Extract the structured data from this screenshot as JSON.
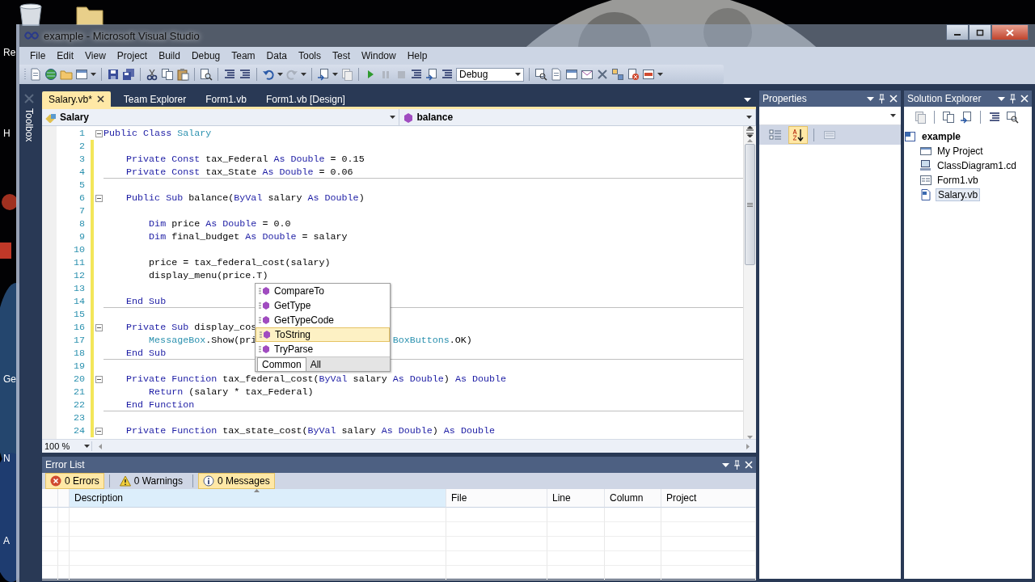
{
  "desktop": {
    "icon_labels": [
      "Re",
      "H",
      "Ge",
      "N",
      "A"
    ]
  },
  "window": {
    "title": "example - Microsoft Visual Studio"
  },
  "menu": [
    "File",
    "Edit",
    "View",
    "Project",
    "Build",
    "Debug",
    "Team",
    "Data",
    "Tools",
    "Test",
    "Window",
    "Help"
  ],
  "toolbar": {
    "configuration": "Debug"
  },
  "toolbox": {
    "label": "Toolbox"
  },
  "editor": {
    "tabs": [
      {
        "label": "Salary.vb*",
        "selected": true,
        "closable": true
      },
      {
        "label": "Team Explorer",
        "selected": false,
        "closable": false
      },
      {
        "label": "Form1.vb",
        "selected": false,
        "closable": false
      },
      {
        "label": "Form1.vb [Design]",
        "selected": false,
        "closable": false
      }
    ],
    "type_dropdown": "Salary",
    "member_dropdown": "balance",
    "lines": [
      {
        "number": "1",
        "foldable": true,
        "changed": false,
        "separator_after": false,
        "segments": [
          {
            "kind": "keyword",
            "text": "Public Class "
          },
          {
            "kind": "type",
            "text": "Salary"
          }
        ]
      },
      {
        "number": "2",
        "foldable": false,
        "changed": true,
        "separator_after": false
      },
      {
        "number": "3",
        "foldable": false,
        "changed": true,
        "separator_after": false,
        "segments": [
          {
            "kind": "keyword",
            "text": "    Private Const"
          },
          {
            "kind": "plain",
            "text": " tax_Federal "
          },
          {
            "kind": "keyword",
            "text": "As Double"
          },
          {
            "kind": "plain",
            "text": " = 0.15"
          }
        ]
      },
      {
        "number": "4",
        "foldable": false,
        "changed": true,
        "separator_after": true,
        "segments": [
          {
            "kind": "keyword",
            "text": "    Private Const"
          },
          {
            "kind": "plain",
            "text": " tax_State "
          },
          {
            "kind": "keyword",
            "text": "As Double"
          },
          {
            "kind": "plain",
            "text": " = 0.06"
          }
        ]
      },
      {
        "number": "5",
        "foldable": false,
        "changed": true,
        "separator_after": false
      },
      {
        "number": "6",
        "foldable": true,
        "changed": true,
        "separator_after": false,
        "segments": [
          {
            "kind": "keyword",
            "text": "    Public Sub"
          },
          {
            "kind": "plain",
            "text": " balance("
          },
          {
            "kind": "keyword",
            "text": "ByVal"
          },
          {
            "kind": "plain",
            "text": " salary "
          },
          {
            "kind": "keyword",
            "text": "As Double"
          },
          {
            "kind": "plain",
            "text": ")"
          }
        ]
      },
      {
        "number": "7",
        "foldable": false,
        "changed": true,
        "separator_after": false
      },
      {
        "number": "8",
        "foldable": false,
        "changed": true,
        "separator_after": false,
        "segments": [
          {
            "kind": "keyword",
            "text": "        Dim"
          },
          {
            "kind": "plain",
            "text": " price "
          },
          {
            "kind": "keyword",
            "text": "As Double"
          },
          {
            "kind": "plain",
            "text": " = 0.0"
          }
        ]
      },
      {
        "number": "9",
        "foldable": false,
        "changed": true,
        "separator_after": false,
        "segments": [
          {
            "kind": "keyword",
            "text": "        Dim"
          },
          {
            "kind": "plain",
            "text": " final_budget "
          },
          {
            "kind": "keyword",
            "text": "As Double"
          },
          {
            "kind": "plain",
            "text": " = salary"
          }
        ]
      },
      {
        "number": "10",
        "foldable": false,
        "changed": true,
        "separator_after": false
      },
      {
        "number": "11",
        "foldable": false,
        "changed": true,
        "separator_after": false,
        "segments": [
          {
            "kind": "plain",
            "text": "        price = tax_federal_cost(salary)"
          }
        ]
      },
      {
        "number": "12",
        "foldable": false,
        "changed": true,
        "separator_after": false,
        "segments": [
          {
            "kind": "plain",
            "text": "        display_menu(price.T)"
          }
        ]
      },
      {
        "number": "13",
        "foldable": false,
        "changed": true,
        "separator_after": false
      },
      {
        "number": "14",
        "foldable": false,
        "changed": true,
        "separator_after": true,
        "segments": [
          {
            "kind": "keyword",
            "text": "    End Sub"
          }
        ]
      },
      {
        "number": "15",
        "foldable": false,
        "changed": true,
        "separator_after": false
      },
      {
        "number": "16",
        "foldable": true,
        "changed": true,
        "separator_after": false,
        "segments": [
          {
            "kind": "keyword",
            "text": "    Private Sub"
          },
          {
            "kind": "plain",
            "text": " display_cos"
          }
        ]
      },
      {
        "number": "17",
        "foldable": false,
        "changed": true,
        "separator_after": false,
        "segments": [
          {
            "kind": "indent"
          },
          {
            "kind": "type",
            "text": "MessageBox"
          },
          {
            "kind": "plain",
            "text": ".Show(pri"
          },
          {
            "kind": "covered"
          },
          {
            "kind": "type",
            "text": "BoxButtons"
          },
          {
            "kind": "plain",
            "text": ".OK)"
          }
        ]
      },
      {
        "number": "18",
        "foldable": false,
        "changed": true,
        "separator_after": true,
        "segments": [
          {
            "kind": "keyword",
            "text": "    End Sub"
          }
        ]
      },
      {
        "number": "19",
        "foldable": false,
        "changed": true,
        "separator_after": false
      },
      {
        "number": "20",
        "foldable": true,
        "changed": true,
        "separator_after": false,
        "segments": [
          {
            "kind": "keyword",
            "text": "    Private Function"
          },
          {
            "kind": "plain",
            "text": " tax_federal_cost("
          },
          {
            "kind": "keyword",
            "text": "ByVal"
          },
          {
            "kind": "plain",
            "text": " salary "
          },
          {
            "kind": "keyword",
            "text": "As Double"
          },
          {
            "kind": "plain",
            "text": ") "
          },
          {
            "kind": "keyword",
            "text": "As Double"
          }
        ]
      },
      {
        "number": "21",
        "foldable": false,
        "changed": true,
        "separator_after": false,
        "segments": [
          {
            "kind": "keyword",
            "text": "        Return"
          },
          {
            "kind": "plain",
            "text": " (salary * tax_Federal)"
          }
        ]
      },
      {
        "number": "22",
        "foldable": false,
        "changed": true,
        "separator_after": true,
        "segments": [
          {
            "kind": "keyword",
            "text": "    End Function"
          }
        ]
      },
      {
        "number": "23",
        "foldable": false,
        "changed": true,
        "separator_after": false
      },
      {
        "number": "24",
        "foldable": true,
        "changed": true,
        "separator_after": false,
        "segments": [
          {
            "kind": "keyword",
            "text": "    Private Function"
          },
          {
            "kind": "plain",
            "text": " tax_state_cost("
          },
          {
            "kind": "keyword",
            "text": "ByVal"
          },
          {
            "kind": "plain",
            "text": " salary "
          },
          {
            "kind": "keyword",
            "text": "As Double"
          },
          {
            "kind": "plain",
            "text": ") "
          },
          {
            "kind": "keyword",
            "text": "As Double"
          }
        ]
      }
    ],
    "completion": {
      "items": [
        {
          "label": "CompareTo",
          "selected": false
        },
        {
          "label": "GetType",
          "selected": false
        },
        {
          "label": "GetTypeCode",
          "selected": false
        },
        {
          "label": "ToString",
          "selected": true
        },
        {
          "label": "TryParse",
          "selected": false
        }
      ],
      "tabs": [
        {
          "label": "Common",
          "selected": true
        },
        {
          "label": "All",
          "selected": false
        }
      ]
    },
    "zoom": "100 %"
  },
  "properties": {
    "title": "Properties",
    "buttons": [
      {
        "kind": "categorized",
        "selected": false,
        "disabled": false
      },
      {
        "kind": "alphabetical",
        "selected": true,
        "disabled": false
      },
      {
        "kind": "property_pages",
        "selected": false,
        "disabled": true
      }
    ]
  },
  "solution_explorer": {
    "title": "Solution Explorer",
    "tree": [
      {
        "label": "example",
        "kind": "project",
        "selected": false,
        "children": [
          {
            "label": "My Project",
            "kind": "my_project",
            "selected": false
          },
          {
            "label": "ClassDiagram1.cd",
            "kind": "class_diagram",
            "selected": false
          },
          {
            "label": "Form1.vb",
            "kind": "form",
            "selected": false
          },
          {
            "label": "Salary.vb",
            "kind": "code_file",
            "selected": true
          }
        ]
      }
    ]
  },
  "error_list": {
    "title": "Error List",
    "filters": [
      {
        "label": "0 Errors",
        "kind": "error",
        "selected": true
      },
      {
        "label": "0 Warnings",
        "kind": "warning",
        "selected": false
      },
      {
        "label": "0 Messages",
        "kind": "message",
        "selected": true
      }
    ],
    "columns": [
      {
        "label": "Description",
        "sorted": true
      },
      {
        "label": "File",
        "sorted": false
      },
      {
        "label": "Line",
        "sorted": false
      },
      {
        "label": "Column",
        "sorted": false
      },
      {
        "label": "Project",
        "sorted": false
      }
    ]
  }
}
